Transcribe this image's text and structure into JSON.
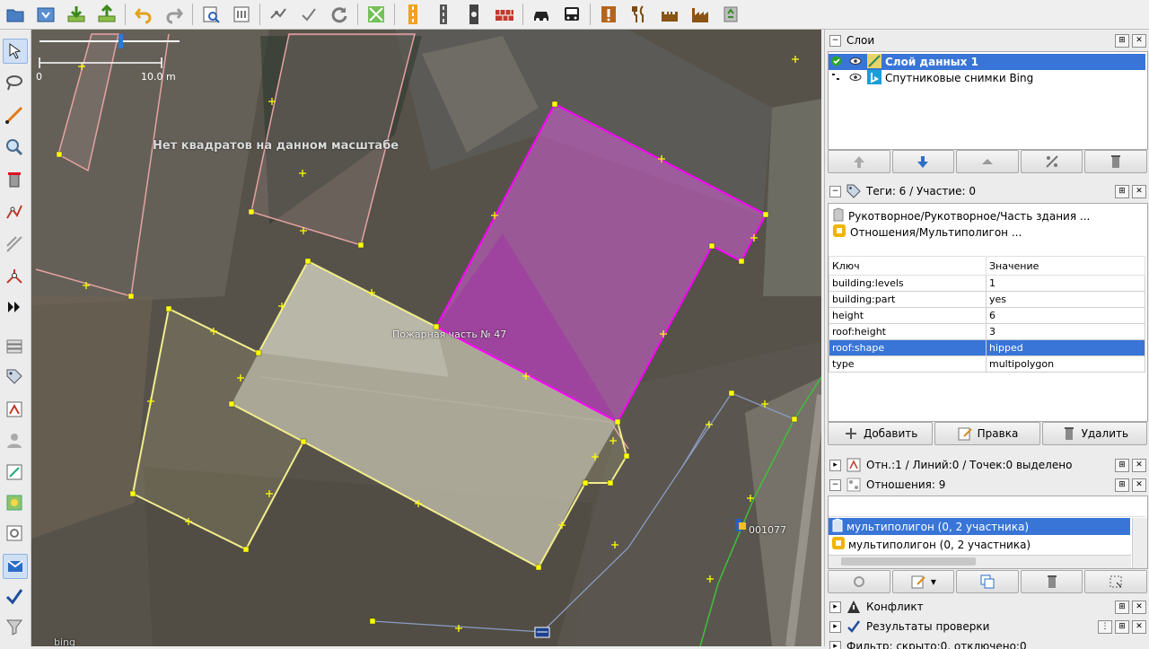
{
  "toolbar": {
    "icons": [
      "open-file-icon",
      "download-icon",
      "download-data-icon",
      "upload-icon",
      "undo-icon",
      "redo-icon",
      "zoom-preview-icon",
      "preferences-icon",
      "wireframe-icon",
      "validator-icon",
      "refresh-icon",
      "map-paint-icon",
      "road-preset-icon",
      "track-preset-icon",
      "railway-preset-icon",
      "wall-preset-icon",
      "car-preset-icon",
      "bus-preset-icon",
      "warning-icon",
      "restaurant-icon",
      "castle-icon",
      "factory-icon",
      "recycling-icon"
    ]
  },
  "map": {
    "scale_start": "0",
    "scale_end": "10.0 m",
    "no_squares_message": "Нет квадратов на данном масштабе",
    "feature_label": "Пожарная часть № 47",
    "address_label": "001077",
    "attribution": "bing"
  },
  "layers_panel": {
    "title": "Слои",
    "layers": [
      {
        "name": "Слой данных 1",
        "selected": true
      },
      {
        "name": "Спутниковые снимки Bing",
        "selected": false
      }
    ]
  },
  "tags_panel": {
    "title": "Теги: 6 / Участие: 0",
    "preset_1": "Рукотворное/Рукотворное/Часть здания ...",
    "preset_2": "Отношения/Мультиполигон ...",
    "col_key": "Ключ",
    "col_value": "Значение",
    "rows": [
      {
        "key": "building:levels",
        "value": "1"
      },
      {
        "key": "building:part",
        "value": "yes"
      },
      {
        "key": "height",
        "value": "6"
      },
      {
        "key": "roof:height",
        "value": "3"
      },
      {
        "key": "roof:shape",
        "value": "hipped"
      },
      {
        "key": "type",
        "value": "multipolygon"
      }
    ],
    "selected_row": 4,
    "add_label": "Добавить",
    "edit_label": "Правка",
    "delete_label": "Удалить"
  },
  "selection_panel": {
    "title": "Отн.:1 / Линий:0 / Точек:0 выделено"
  },
  "relations_panel": {
    "title": "Отношения: 9",
    "items": [
      {
        "label": "мультиполигон (0, 2 участника)",
        "selected": true
      },
      {
        "label": "мультиполигон (0, 2 участника)",
        "selected": false
      }
    ]
  },
  "conflict_panel": {
    "title": "Конфликт"
  },
  "validation_panel": {
    "title": "Результаты проверки"
  },
  "filter_panel": {
    "title": "Фильтр: скрыто:0, отключено:0"
  },
  "colors": {
    "selection": "#3875d7",
    "selected_way": "#ff00ff",
    "building_outline": "#f2ee8c"
  }
}
